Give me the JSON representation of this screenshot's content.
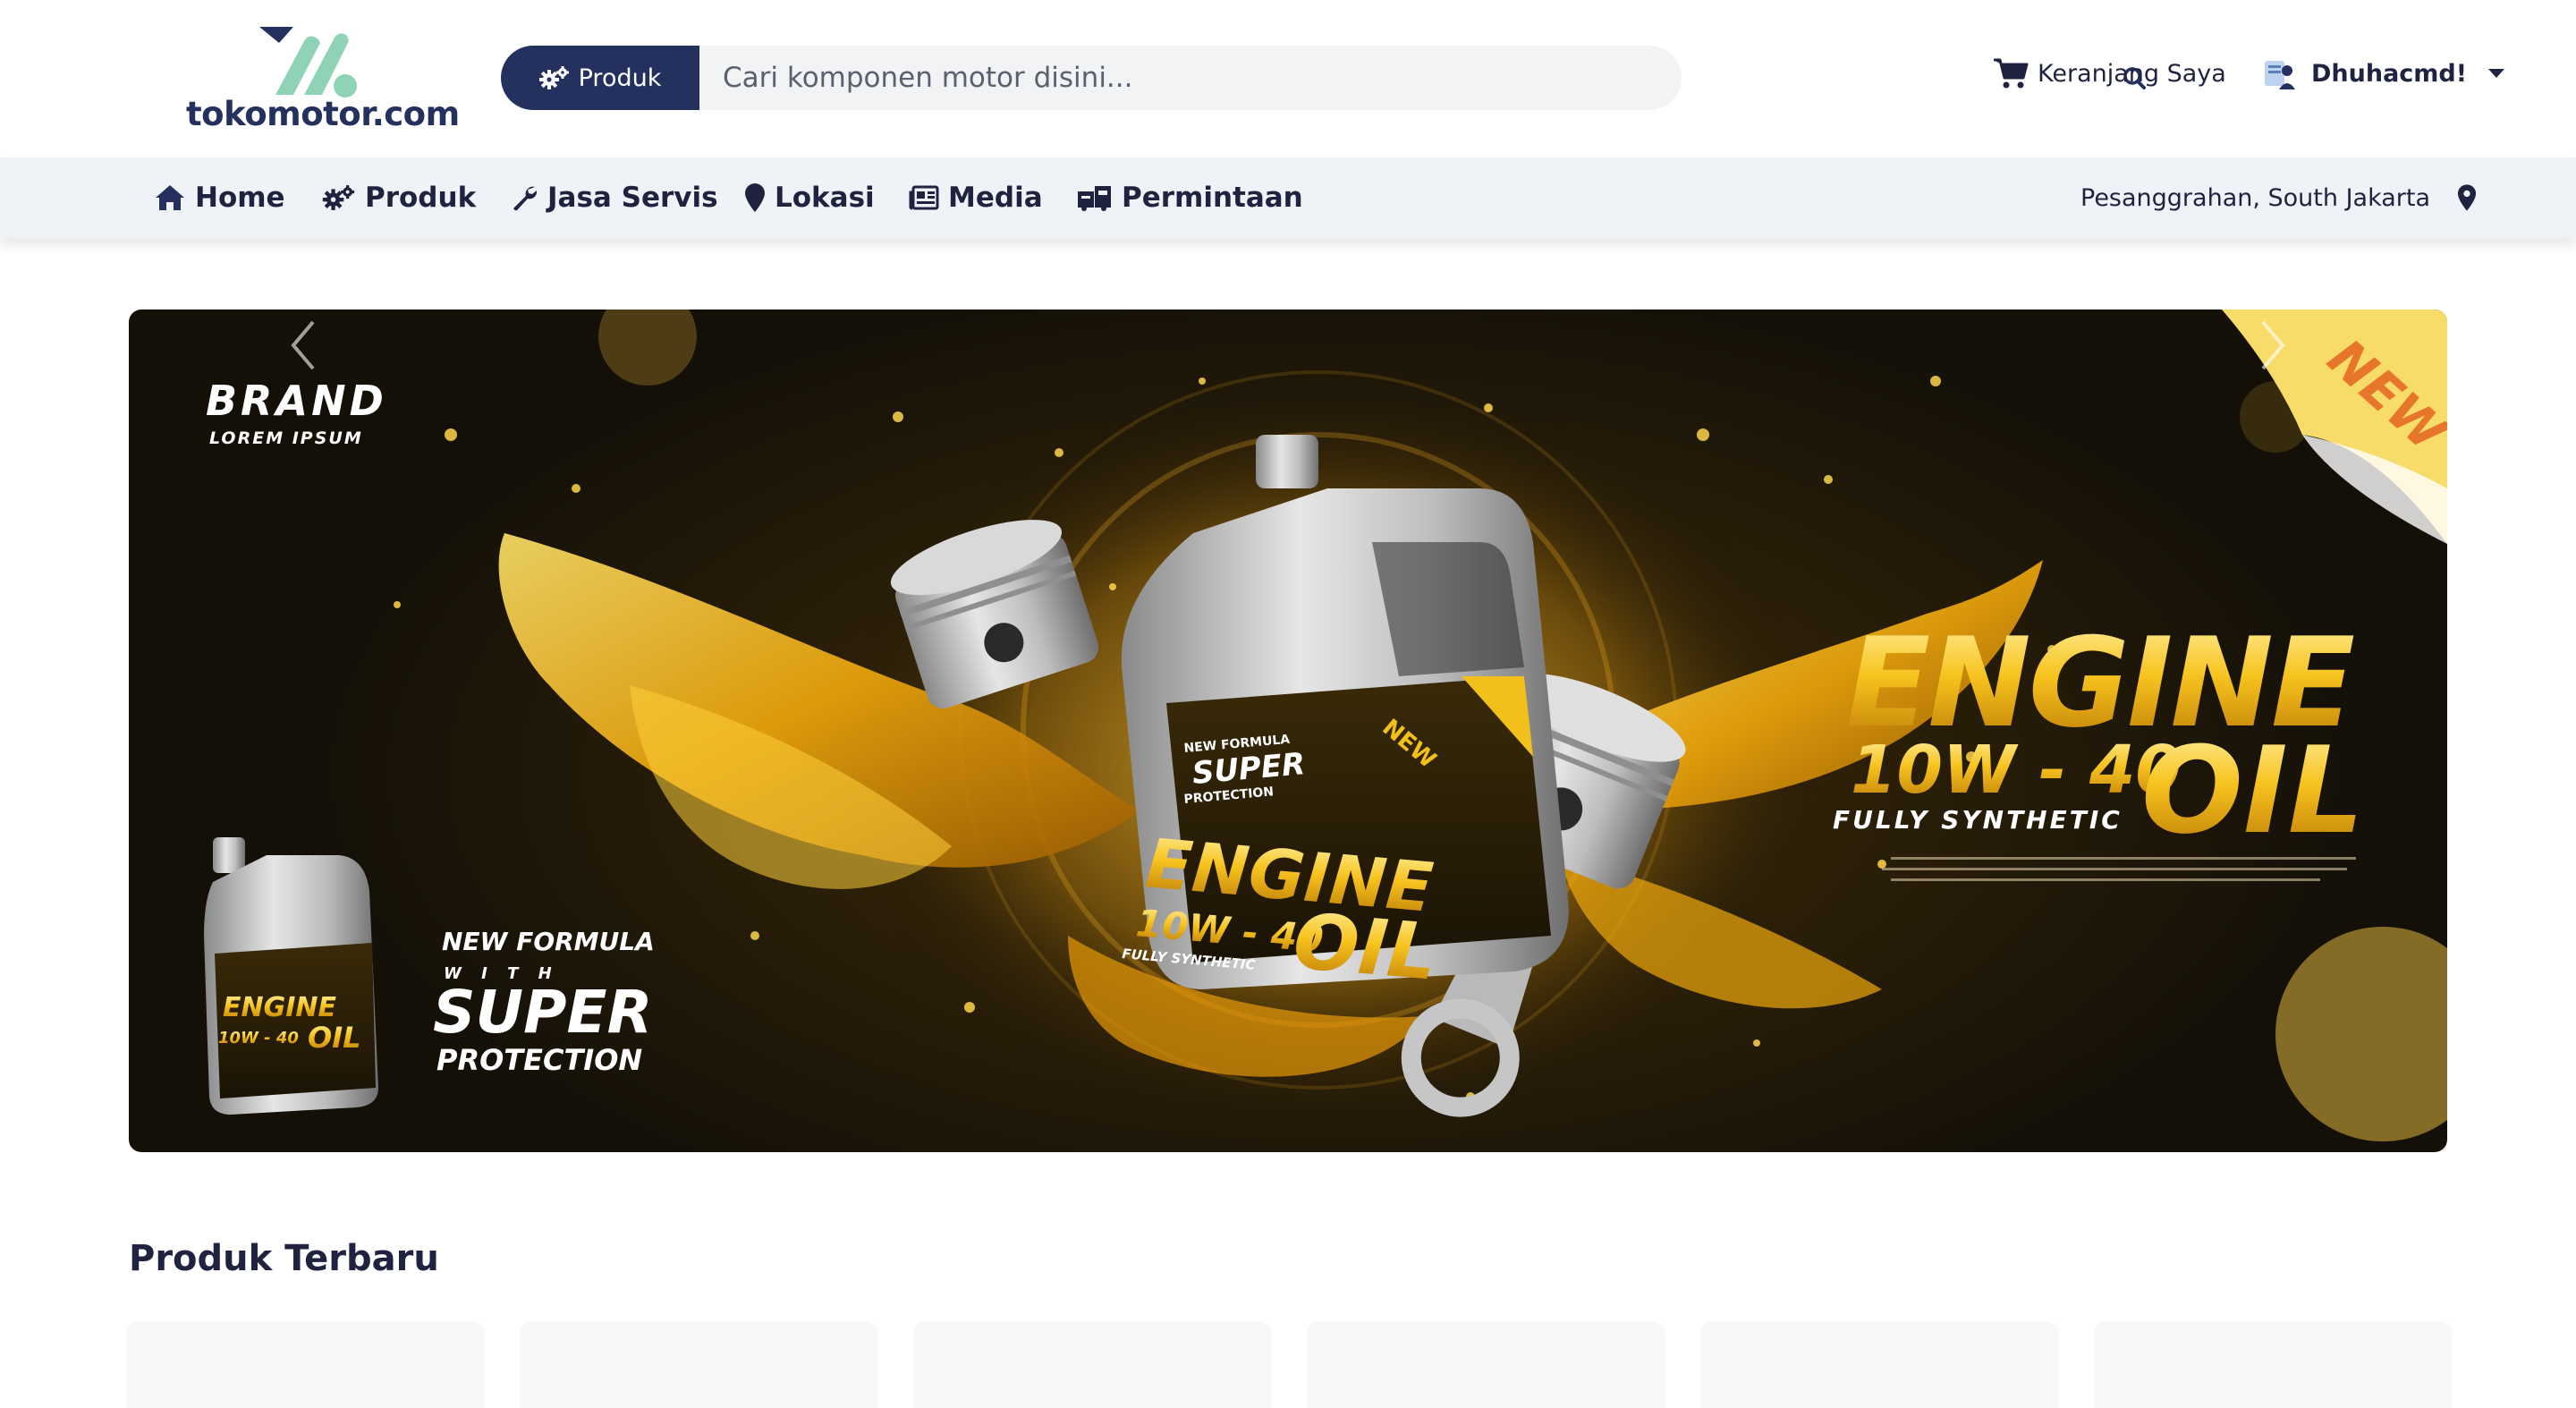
{
  "brand": {
    "name": "tokomotor.com"
  },
  "header": {
    "search": {
      "category_label": "Produk",
      "placeholder": "Cari komponen motor disini..."
    },
    "cart_label": "Keranjang Saya",
    "user_name": "Dhuhacmd!"
  },
  "nav": {
    "items": [
      {
        "label": "Home",
        "icon": "home-icon"
      },
      {
        "label": "Produk",
        "icon": "gears-icon"
      },
      {
        "label": "Jasa Servis",
        "icon": "wrench-icon"
      },
      {
        "label": "Lokasi",
        "icon": "map-pin-icon"
      },
      {
        "label": "Media",
        "icon": "newspaper-icon"
      },
      {
        "label": "Permintaan",
        "icon": "truck-request-icon"
      }
    ],
    "location": "Pesanggrahan, South Jakarta"
  },
  "banner": {
    "brand_title": "BRAND",
    "brand_sub": "LOREM IPSUM",
    "corner_tag": "NEW",
    "headline_1": "ENGINE",
    "headline_2": "10W - 40",
    "headline_3": "OIL",
    "headline_4": "FULLY SYNTHETIC",
    "tagline_1": "NEW FORMULA",
    "tagline_2": "W I T H",
    "tagline_3": "SUPER",
    "tagline_4": "PROTECTION",
    "bottle_label_1": "ENGINE",
    "bottle_label_2": "10W - 40",
    "bottle_label_3": "OIL",
    "bottle_label_4": "FULLY SYNTHETIC",
    "bottle_badge": "NEW",
    "bottle_super_1": "NEW FORMULA",
    "bottle_super_2": "SUPER",
    "bottle_super_3": "PROTECTION"
  },
  "sections": {
    "latest_title": "Produk Terbaru"
  },
  "colors": {
    "primary": "#24305e",
    "logo_accent": "#8fd3b6",
    "nav_bg": "#eff2f7",
    "gold": "#f5c21b"
  }
}
